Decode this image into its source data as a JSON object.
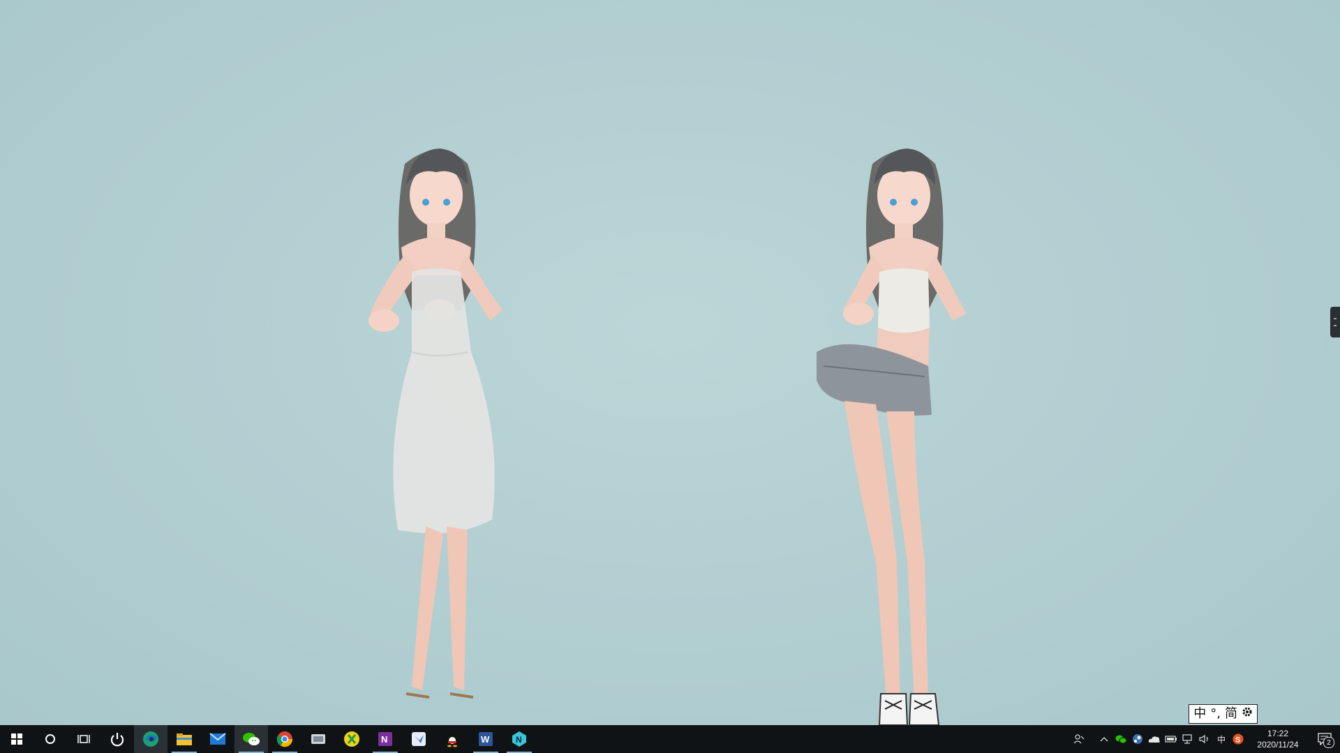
{
  "desktop": {
    "wallpaper_description": "",
    "colors": {
      "wallpaper": "#b3cfd2",
      "taskbar": "#101316",
      "accent": "#7fb6e6"
    }
  },
  "ime": {
    "mode": "中",
    "punct": "°,",
    "charset": "简",
    "settings_icon": "gear-icon"
  },
  "taskbar": {
    "start_icon": "windows-logo-icon",
    "search_icon": "cortana-circle-icon",
    "taskview_icon": "task-view-icon",
    "pinned": [
      {
        "name": "power-icon",
        "running": false
      },
      {
        "name": "edge-icon",
        "running": false,
        "active": true
      },
      {
        "name": "file-explorer-icon",
        "running": true
      },
      {
        "name": "mail-icon",
        "running": false
      },
      {
        "name": "wechat-icon",
        "running": true,
        "active": true
      },
      {
        "name": "chrome-icon",
        "running": true
      },
      {
        "name": "app-generic-icon",
        "running": false
      },
      {
        "name": "xunlei-icon",
        "running": false
      },
      {
        "name": "onenote-icon",
        "running": true
      },
      {
        "name": "feishu-icon",
        "running": false
      },
      {
        "name": "qq-icon",
        "running": false
      },
      {
        "name": "word-icon",
        "running": true
      },
      {
        "name": "n-app-icon",
        "running": true
      }
    ]
  },
  "tray": {
    "ime_indicator": "中",
    "time": "17:22",
    "date": "2020/11/24",
    "notification_count": "2"
  }
}
